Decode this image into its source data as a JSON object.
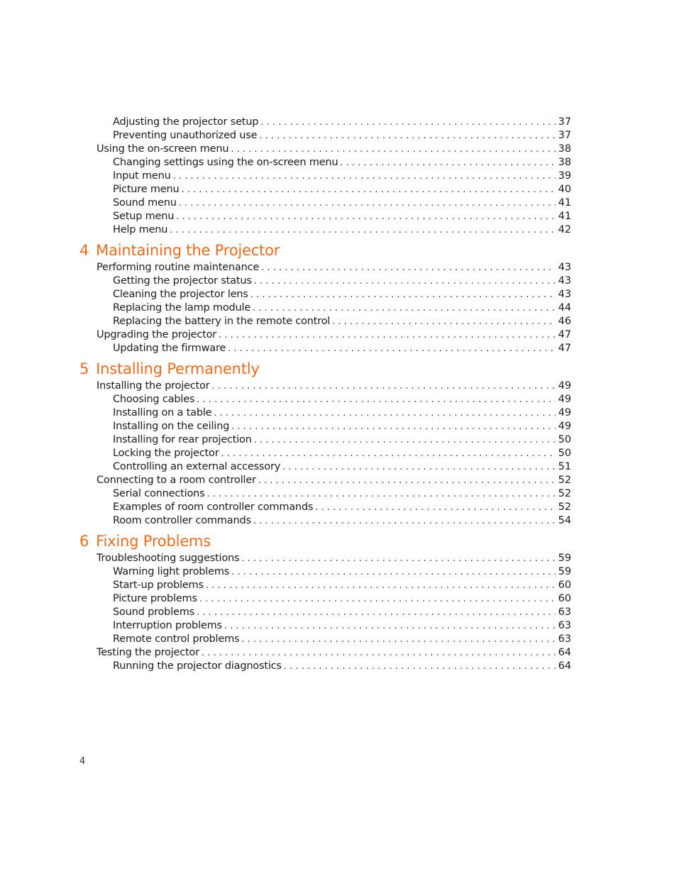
{
  "accent_color": "#f26a1b",
  "page_number": "4",
  "blocks": [
    {
      "type": "entry",
      "level": 2,
      "title": "Adjusting the projector setup",
      "page": "37"
    },
    {
      "type": "entry",
      "level": 2,
      "title": "Preventing unauthorized use",
      "page": "37"
    },
    {
      "type": "entry",
      "level": 1,
      "title": "Using the on-screen menu",
      "page": "38"
    },
    {
      "type": "entry",
      "level": 2,
      "title": "Changing settings using the on-screen menu",
      "page": "38"
    },
    {
      "type": "entry",
      "level": 2,
      "title": "Input menu",
      "page": "39"
    },
    {
      "type": "entry",
      "level": 2,
      "title": "Picture menu",
      "page": "40"
    },
    {
      "type": "entry",
      "level": 2,
      "title": "Sound menu",
      "page": "41"
    },
    {
      "type": "entry",
      "level": 2,
      "title": "Setup menu",
      "page": "41"
    },
    {
      "type": "entry",
      "level": 2,
      "title": "Help menu",
      "page": "42"
    },
    {
      "type": "chapter",
      "number": "4",
      "title": "Maintaining the Projector"
    },
    {
      "type": "entry",
      "level": 1,
      "title": "Performing routine maintenance",
      "page": "43"
    },
    {
      "type": "entry",
      "level": 2,
      "title": "Getting the projector status",
      "page": "43"
    },
    {
      "type": "entry",
      "level": 2,
      "title": "Cleaning the projector lens",
      "page": "43"
    },
    {
      "type": "entry",
      "level": 2,
      "title": "Replacing the lamp module",
      "page": "44"
    },
    {
      "type": "entry",
      "level": 2,
      "title": "Replacing the battery in the remote control",
      "page": "46"
    },
    {
      "type": "entry",
      "level": 1,
      "title": "Upgrading the projector",
      "page": "47"
    },
    {
      "type": "entry",
      "level": 2,
      "title": "Updating the firmware",
      "page": "47"
    },
    {
      "type": "chapter",
      "number": "5",
      "title": "Installing Permanently"
    },
    {
      "type": "entry",
      "level": 1,
      "title": "Installing the projector",
      "page": "49"
    },
    {
      "type": "entry",
      "level": 2,
      "title": "Choosing cables",
      "page": "49"
    },
    {
      "type": "entry",
      "level": 2,
      "title": "Installing on a table",
      "page": "49"
    },
    {
      "type": "entry",
      "level": 2,
      "title": "Installing on the ceiling",
      "page": "49"
    },
    {
      "type": "entry",
      "level": 2,
      "title": "Installing for rear projection",
      "page": "50"
    },
    {
      "type": "entry",
      "level": 2,
      "title": "Locking the projector",
      "page": "50"
    },
    {
      "type": "entry",
      "level": 2,
      "title": "Controlling an external accessory",
      "page": "51"
    },
    {
      "type": "entry",
      "level": 1,
      "title": "Connecting to a room controller",
      "page": "52"
    },
    {
      "type": "entry",
      "level": 2,
      "title": "Serial connections",
      "page": "52"
    },
    {
      "type": "entry",
      "level": 2,
      "title": "Examples of room controller commands",
      "page": "52"
    },
    {
      "type": "entry",
      "level": 2,
      "title": "Room controller commands",
      "page": "54"
    },
    {
      "type": "chapter",
      "number": "6",
      "title": "Fixing Problems"
    },
    {
      "type": "entry",
      "level": 1,
      "title": "Troubleshooting suggestions",
      "page": "59"
    },
    {
      "type": "entry",
      "level": 2,
      "title": "Warning light problems",
      "page": "59"
    },
    {
      "type": "entry",
      "level": 2,
      "title": "Start-up problems",
      "page": "60"
    },
    {
      "type": "entry",
      "level": 2,
      "title": "Picture problems",
      "page": "60"
    },
    {
      "type": "entry",
      "level": 2,
      "title": "Sound problems",
      "page": "63"
    },
    {
      "type": "entry",
      "level": 2,
      "title": "Interruption problems",
      "page": "63"
    },
    {
      "type": "entry",
      "level": 2,
      "title": "Remote control problems",
      "page": "63"
    },
    {
      "type": "entry",
      "level": 1,
      "title": "Testing the projector",
      "page": "64"
    },
    {
      "type": "entry",
      "level": 2,
      "title": "Running the projector diagnostics",
      "page": "64"
    }
  ]
}
